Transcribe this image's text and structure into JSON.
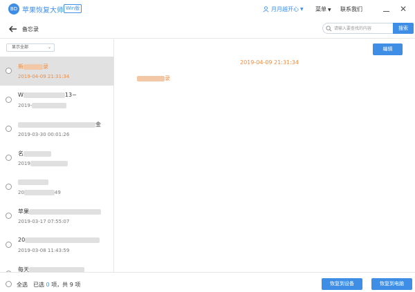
{
  "app": {
    "logo_text": "BD",
    "title": "苹果恢复大师",
    "edition": "Win版",
    "user_name": "月月越开心",
    "menu_label": "菜单",
    "contact_label": "联系我们"
  },
  "header": {
    "page_title": "备忘录",
    "search_placeholder": "请输入要查找的内容",
    "search_button": "搜索"
  },
  "filter": {
    "selected": "显示全部"
  },
  "notes": [
    {
      "title_prefix": "新",
      "title_suffix": "录",
      "date": "2019-04-09 21:31:34",
      "selected": true
    },
    {
      "title_prefix": "W",
      "title_suffix": "13~",
      "date": "2019-",
      "selected": false
    },
    {
      "title_prefix": "",
      "title_suffix": "金",
      "date": "2019-03-30 00:01:26",
      "selected": false
    },
    {
      "title_prefix": "名",
      "title_suffix": "",
      "date": "2019",
      "selected": false
    },
    {
      "title_prefix": "",
      "title_suffix": "",
      "date": "20",
      "date_suffix": "49",
      "selected": false
    },
    {
      "title_prefix": "苹果",
      "title_suffix": "",
      "date": "2019-03-17 07:55:07",
      "selected": false
    },
    {
      "title_prefix": "20",
      "title_suffix": "",
      "date": "2019-03-08 11:43:59",
      "selected": false
    },
    {
      "title_prefix": "每天",
      "title_suffix": "",
      "date": "",
      "selected": false
    }
  ],
  "detail": {
    "edit_button": "编辑",
    "date": "2019-04-09 21:31:34",
    "title_suffix": "录"
  },
  "footer": {
    "select_all": "全选",
    "selected_label": "已选",
    "selected_count": "0",
    "items_label": "项，共",
    "total_count": "9",
    "items_unit": "项",
    "restore_device": "恢复到设备",
    "restore_pc": "恢复到电脑"
  },
  "colors": {
    "accent": "#3e8ee6",
    "highlight": "#f08a3c",
    "selected_row": "#e1e1e1"
  }
}
